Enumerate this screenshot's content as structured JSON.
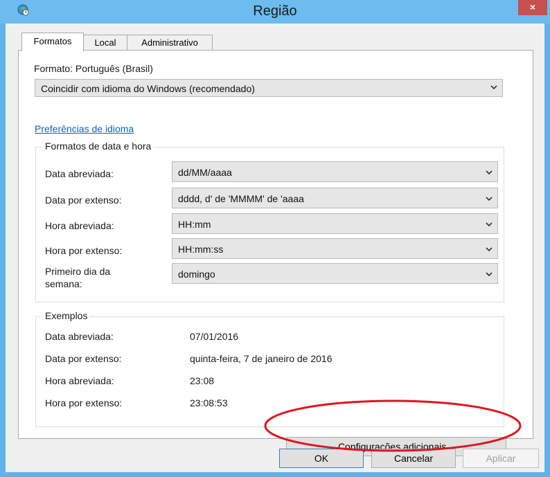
{
  "window": {
    "title": "Região",
    "close_symbol": "×",
    "app_icon": "globe-clock-icon"
  },
  "tabs": [
    {
      "label": "Formatos",
      "active": true
    },
    {
      "label": "Local",
      "active": false
    },
    {
      "label": "Administrativo",
      "active": false
    }
  ],
  "format": {
    "label": "Formato: Português (Brasil)",
    "selected": "Coincidir com idioma do Windows (recomendado)"
  },
  "language_prefs_link": "Preferências de idioma",
  "date_time_formats": {
    "caption": "Formatos de data e hora",
    "rows": [
      {
        "label": "Data abreviada:",
        "value": "dd/MM/aaaa"
      },
      {
        "label": "Data por extenso:",
        "value": "dddd, d' de 'MMMM' de 'aaaa"
      },
      {
        "label": "Hora abreviada:",
        "value": "HH:mm"
      },
      {
        "label": "Hora por extenso:",
        "value": "HH:mm:ss"
      },
      {
        "label": "Primeiro dia da semana:",
        "value": "domingo"
      }
    ]
  },
  "examples": {
    "caption": "Exemplos",
    "rows": [
      {
        "label": "Data abreviada:",
        "value": "07/01/2016"
      },
      {
        "label": "Data por extenso:",
        "value": "quinta-feira, 7 de janeiro de 2016"
      },
      {
        "label": "Hora abreviada:",
        "value": "23:08"
      },
      {
        "label": "Hora por extenso:",
        "value": "23:08:53"
      }
    ]
  },
  "buttons": {
    "additional_settings": "Configurações adicionais...",
    "ok": "OK",
    "cancel": "Cancelar",
    "apply": "Aplicar"
  },
  "colors": {
    "titlebar": "#6cbcef",
    "close_button": "#c75050",
    "link": "#0066cc",
    "annotation_ellipse": "#e0141e"
  }
}
